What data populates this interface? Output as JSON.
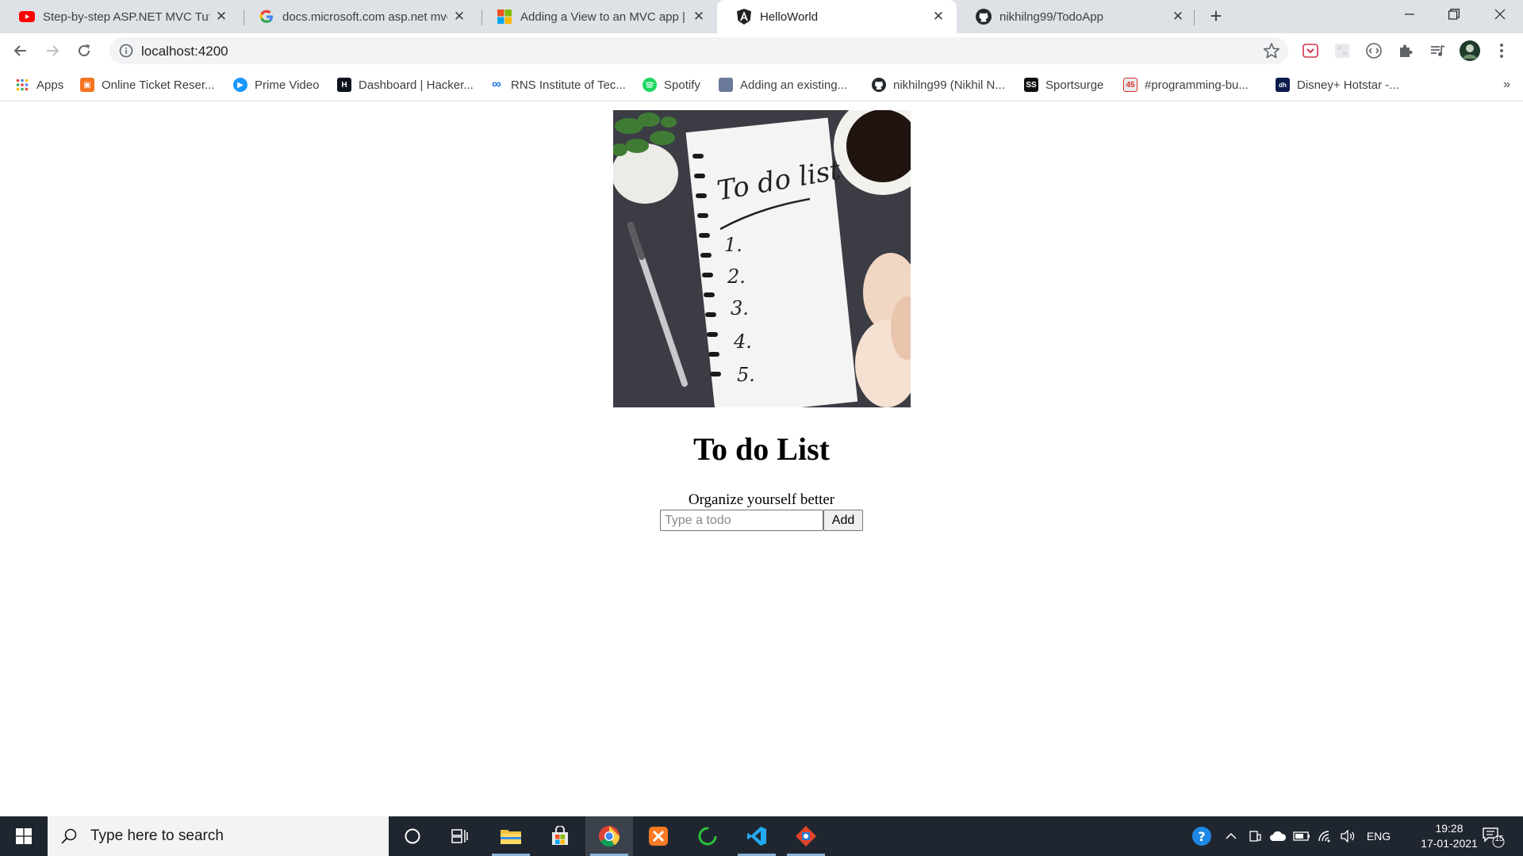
{
  "browser": {
    "tabs": [
      {
        "title": "Step-by-step ASP.NET MVC Tutorial",
        "favicon": "youtube-icon",
        "active": false
      },
      {
        "title": "docs.microsoft.com asp.net mvc",
        "favicon": "google-icon",
        "active": false
      },
      {
        "title": "Adding a View to an MVC app | Microsoft",
        "favicon": "microsoft-icon",
        "active": false
      },
      {
        "title": "HelloWorld",
        "favicon": "angular-icon",
        "active": true
      },
      {
        "title": "nikhilng99/TodoApp",
        "favicon": "github-icon",
        "active": false
      }
    ],
    "address": "localhost:4200",
    "bookmarks": [
      {
        "label": "Apps",
        "icon": "apps-grid-icon"
      },
      {
        "label": "Online Ticket Reser...",
        "icon": "ticket-icon"
      },
      {
        "label": "Prime Video",
        "icon": "prime-video-icon"
      },
      {
        "label": "Dashboard | Hacker...",
        "icon": "hackerrank-icon"
      },
      {
        "label": "RNS Institute of Tec...",
        "icon": "infinity-icon"
      },
      {
        "label": "Spotify",
        "icon": "spotify-icon"
      },
      {
        "label": "Adding an existing...",
        "icon": "page-icon"
      },
      {
        "label": "nikhilng99 (Nikhil N...",
        "icon": "github-icon"
      },
      {
        "label": "Sportsurge",
        "icon": "sportsurge-icon"
      },
      {
        "label": "#programming-bu...",
        "icon": "slack-badge-icon"
      },
      {
        "label": "Disney+ Hotstar -...",
        "icon": "hotstar-icon"
      }
    ],
    "bookmarks_overflow": "»"
  },
  "page": {
    "hero_image": {
      "alt": "To do list notebook",
      "heading": "To do list",
      "items": [
        "1.",
        "2.",
        "3.",
        "4.",
        "5."
      ]
    },
    "title": "To do List",
    "subtitle": "Organize yourself better",
    "input_placeholder": "Type a todo",
    "add_label": "Add"
  },
  "taskbar": {
    "search_placeholder": "Type here to search",
    "lang": "ENG",
    "time": "19:28",
    "date": "17-01-2021",
    "notifications": "15"
  }
}
